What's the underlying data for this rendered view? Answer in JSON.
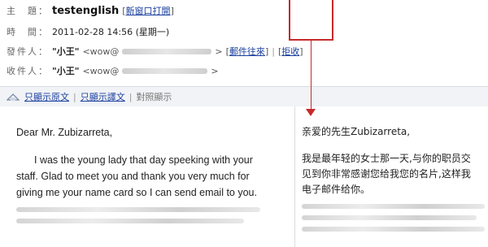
{
  "header": {
    "subject_label": "主　題：",
    "subject_value": "testenglish",
    "subject_link": "新窗口打開",
    "time_label": "時　間：",
    "time_value": "2011-02-28 14:56 (星期一)",
    "from_label": "發件人：",
    "from_name": "\"小王\"",
    "from_email_prefix": "<wow@",
    "from_email_suffix": ">",
    "from_link1": "郵件往來",
    "from_link2": "拒收",
    "to_label": "收件人：",
    "to_name": "\"小王\"",
    "to_email_prefix": "<wow@",
    "to_email_suffix": ">"
  },
  "toolbar": {
    "show_original": "只顯示原文",
    "show_translation": "只顯示譯文",
    "compare": "對照顯示"
  },
  "body_en": {
    "greeting": "Dear Mr. Zubizarreta,",
    "paragraph": "I was the young lady that day speeking with your staff. Glad to meet you and thank  you very much for giving me your name card so I can send email to you."
  },
  "body_zh": {
    "greeting": "亲爱的先生Zubizarreta,",
    "line1": "我是最年轻的女士那一天,与你的职员交",
    "line2": "见到你非常感谢您给我您的名片,这样我",
    "line3": "电子邮件给你。"
  },
  "colors": {
    "link": "#1a3f9e",
    "annotation": "#c62a2a",
    "toolbar_bg": "#f1f3f6"
  }
}
